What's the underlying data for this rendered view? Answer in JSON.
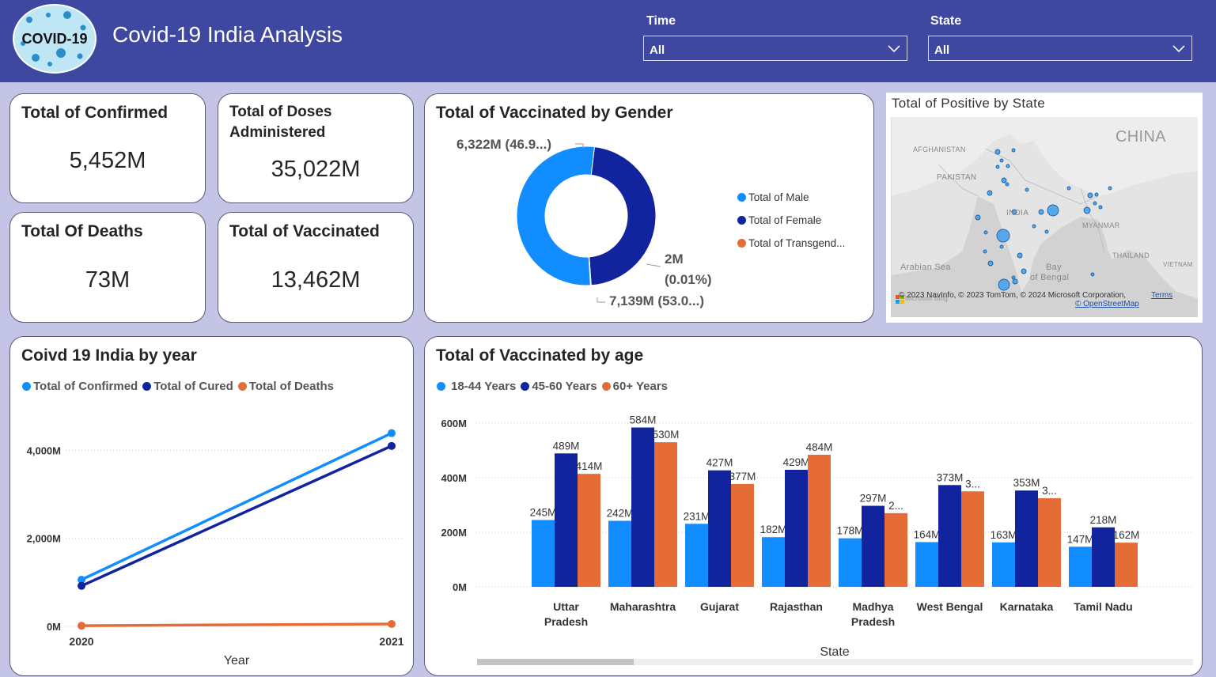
{
  "header": {
    "app_title": "Covid-19 India Analysis",
    "logo_text": "COVID-19",
    "filters": [
      {
        "label": "Time",
        "value": "All"
      },
      {
        "label": "State",
        "value": "All"
      }
    ]
  },
  "kpis": [
    {
      "title": "Total of Confirmed",
      "value": "5,452M"
    },
    {
      "title": "Total of Doses Administered",
      "value": "35,022M"
    },
    {
      "title": "Total Of Deaths",
      "value": "73M"
    },
    {
      "title": "Total of Vaccinated",
      "value": "13,462M"
    }
  ],
  "gender_chart": {
    "title": "Total of Vaccinated by Gender",
    "labels": {
      "female": "6,322M (46.9...)",
      "trans_value": "2M",
      "trans_pct": "(0.01%)",
      "male": "7,139M (53.0...)"
    },
    "legend": [
      {
        "name": "Total of Male",
        "color": "#118dff"
      },
      {
        "name": "Total of Female",
        "color": "#12239e"
      },
      {
        "name": "Total of Transgend...",
        "color": "#e66c37"
      }
    ]
  },
  "map": {
    "title": "Total of Positive by State",
    "labels": {
      "china": "CHINA",
      "afghanistan": "AFGHANISTAN",
      "pakistan": "PAKISTAN",
      "india": "INDIA",
      "myanmar": "MYANMAR",
      "thailand": "THAILAND",
      "vietnam": "VIETNAM",
      "arabian_sea": "Arabian Sea",
      "bay_line1": "Bay",
      "bay_line2": "of Bengal"
    },
    "attribution": "© 2023 NavInfo, © 2023 TomTom, © 2024 Microsoft Corporation,",
    "terms_link": "Terms",
    "osm_link": "© OpenStreetMap",
    "bing": "Microsoft Bing"
  },
  "year_chart": {
    "title": "Coivd 19 India by year",
    "legend": [
      {
        "name": "Total of Confirmed",
        "color": "#118dff"
      },
      {
        "name": "Total of Cured",
        "color": "#12239e"
      },
      {
        "name": "Total of Deaths",
        "color": "#e66c37"
      }
    ],
    "xlabel": "Year",
    "y_ticks": [
      "4,000M",
      "2,000M",
      "0M"
    ]
  },
  "age_chart": {
    "title": "Total of Vaccinated by age",
    "legend": [
      {
        "name": "18-44 Years",
        "color": "#118dff"
      },
      {
        "name": "45-60 Years",
        "color": "#12239e"
      },
      {
        "name": "60+ Years",
        "color": "#e66c37"
      }
    ],
    "xlabel": "State",
    "y_ticks": [
      "600M",
      "400M",
      "200M",
      "0M"
    ]
  },
  "chart_data": [
    {
      "type": "pie",
      "title": "Total of Vaccinated by Gender",
      "categories": [
        "Total of Male",
        "Total of Female",
        "Total of Transgend..."
      ],
      "values": [
        7139,
        6322,
        2
      ],
      "unit": "M",
      "legend": "right"
    },
    {
      "type": "line",
      "title": "Coivd 19 India by year",
      "x": [
        "2020",
        "2021"
      ],
      "xlabel": "Year",
      "ylabel": "",
      "ylim": [
        0,
        4600
      ],
      "series": [
        {
          "name": "Total of Confirmed",
          "values": [
            1060,
            4390
          ]
        },
        {
          "name": "Total of Cured",
          "values": [
            920,
            4100
          ]
        },
        {
          "name": "Total of Deaths",
          "values": [
            15,
            55
          ]
        }
      ],
      "grid": true,
      "legend": "top-left"
    },
    {
      "type": "bar",
      "title": "Total of Vaccinated by age",
      "categories": [
        "Uttar Pradesh",
        "Maharashtra",
        "Gujarat",
        "Rajasthan",
        "Madhya Pradesh",
        "West Bengal",
        "Karnataka",
        "Tamil Nadu"
      ],
      "xlabel": "State",
      "ylabel": "",
      "ylim": [
        0,
        600
      ],
      "series": [
        {
          "name": "18-44 Years",
          "values": [
            245,
            242,
            231,
            182,
            178,
            164,
            163,
            147
          ],
          "labels": [
            "245M",
            "242M",
            "231M",
            "182M",
            "178M",
            "164M",
            "163M",
            "147M"
          ]
        },
        {
          "name": "45-60 Years",
          "values": [
            489,
            584,
            427,
            429,
            297,
            373,
            353,
            218
          ],
          "labels": [
            "489M",
            "584M",
            "427M",
            "429M",
            "297M",
            "373M",
            "353M",
            "218M"
          ]
        },
        {
          "name": "60+ Years",
          "values": [
            414,
            530,
            377,
            484,
            270,
            350,
            325,
            162
          ],
          "labels": [
            "414M",
            "530M",
            "377M",
            "484M",
            "2...",
            "3...",
            "3...",
            "162M"
          ]
        }
      ],
      "grid": true,
      "legend": "top-left"
    }
  ]
}
